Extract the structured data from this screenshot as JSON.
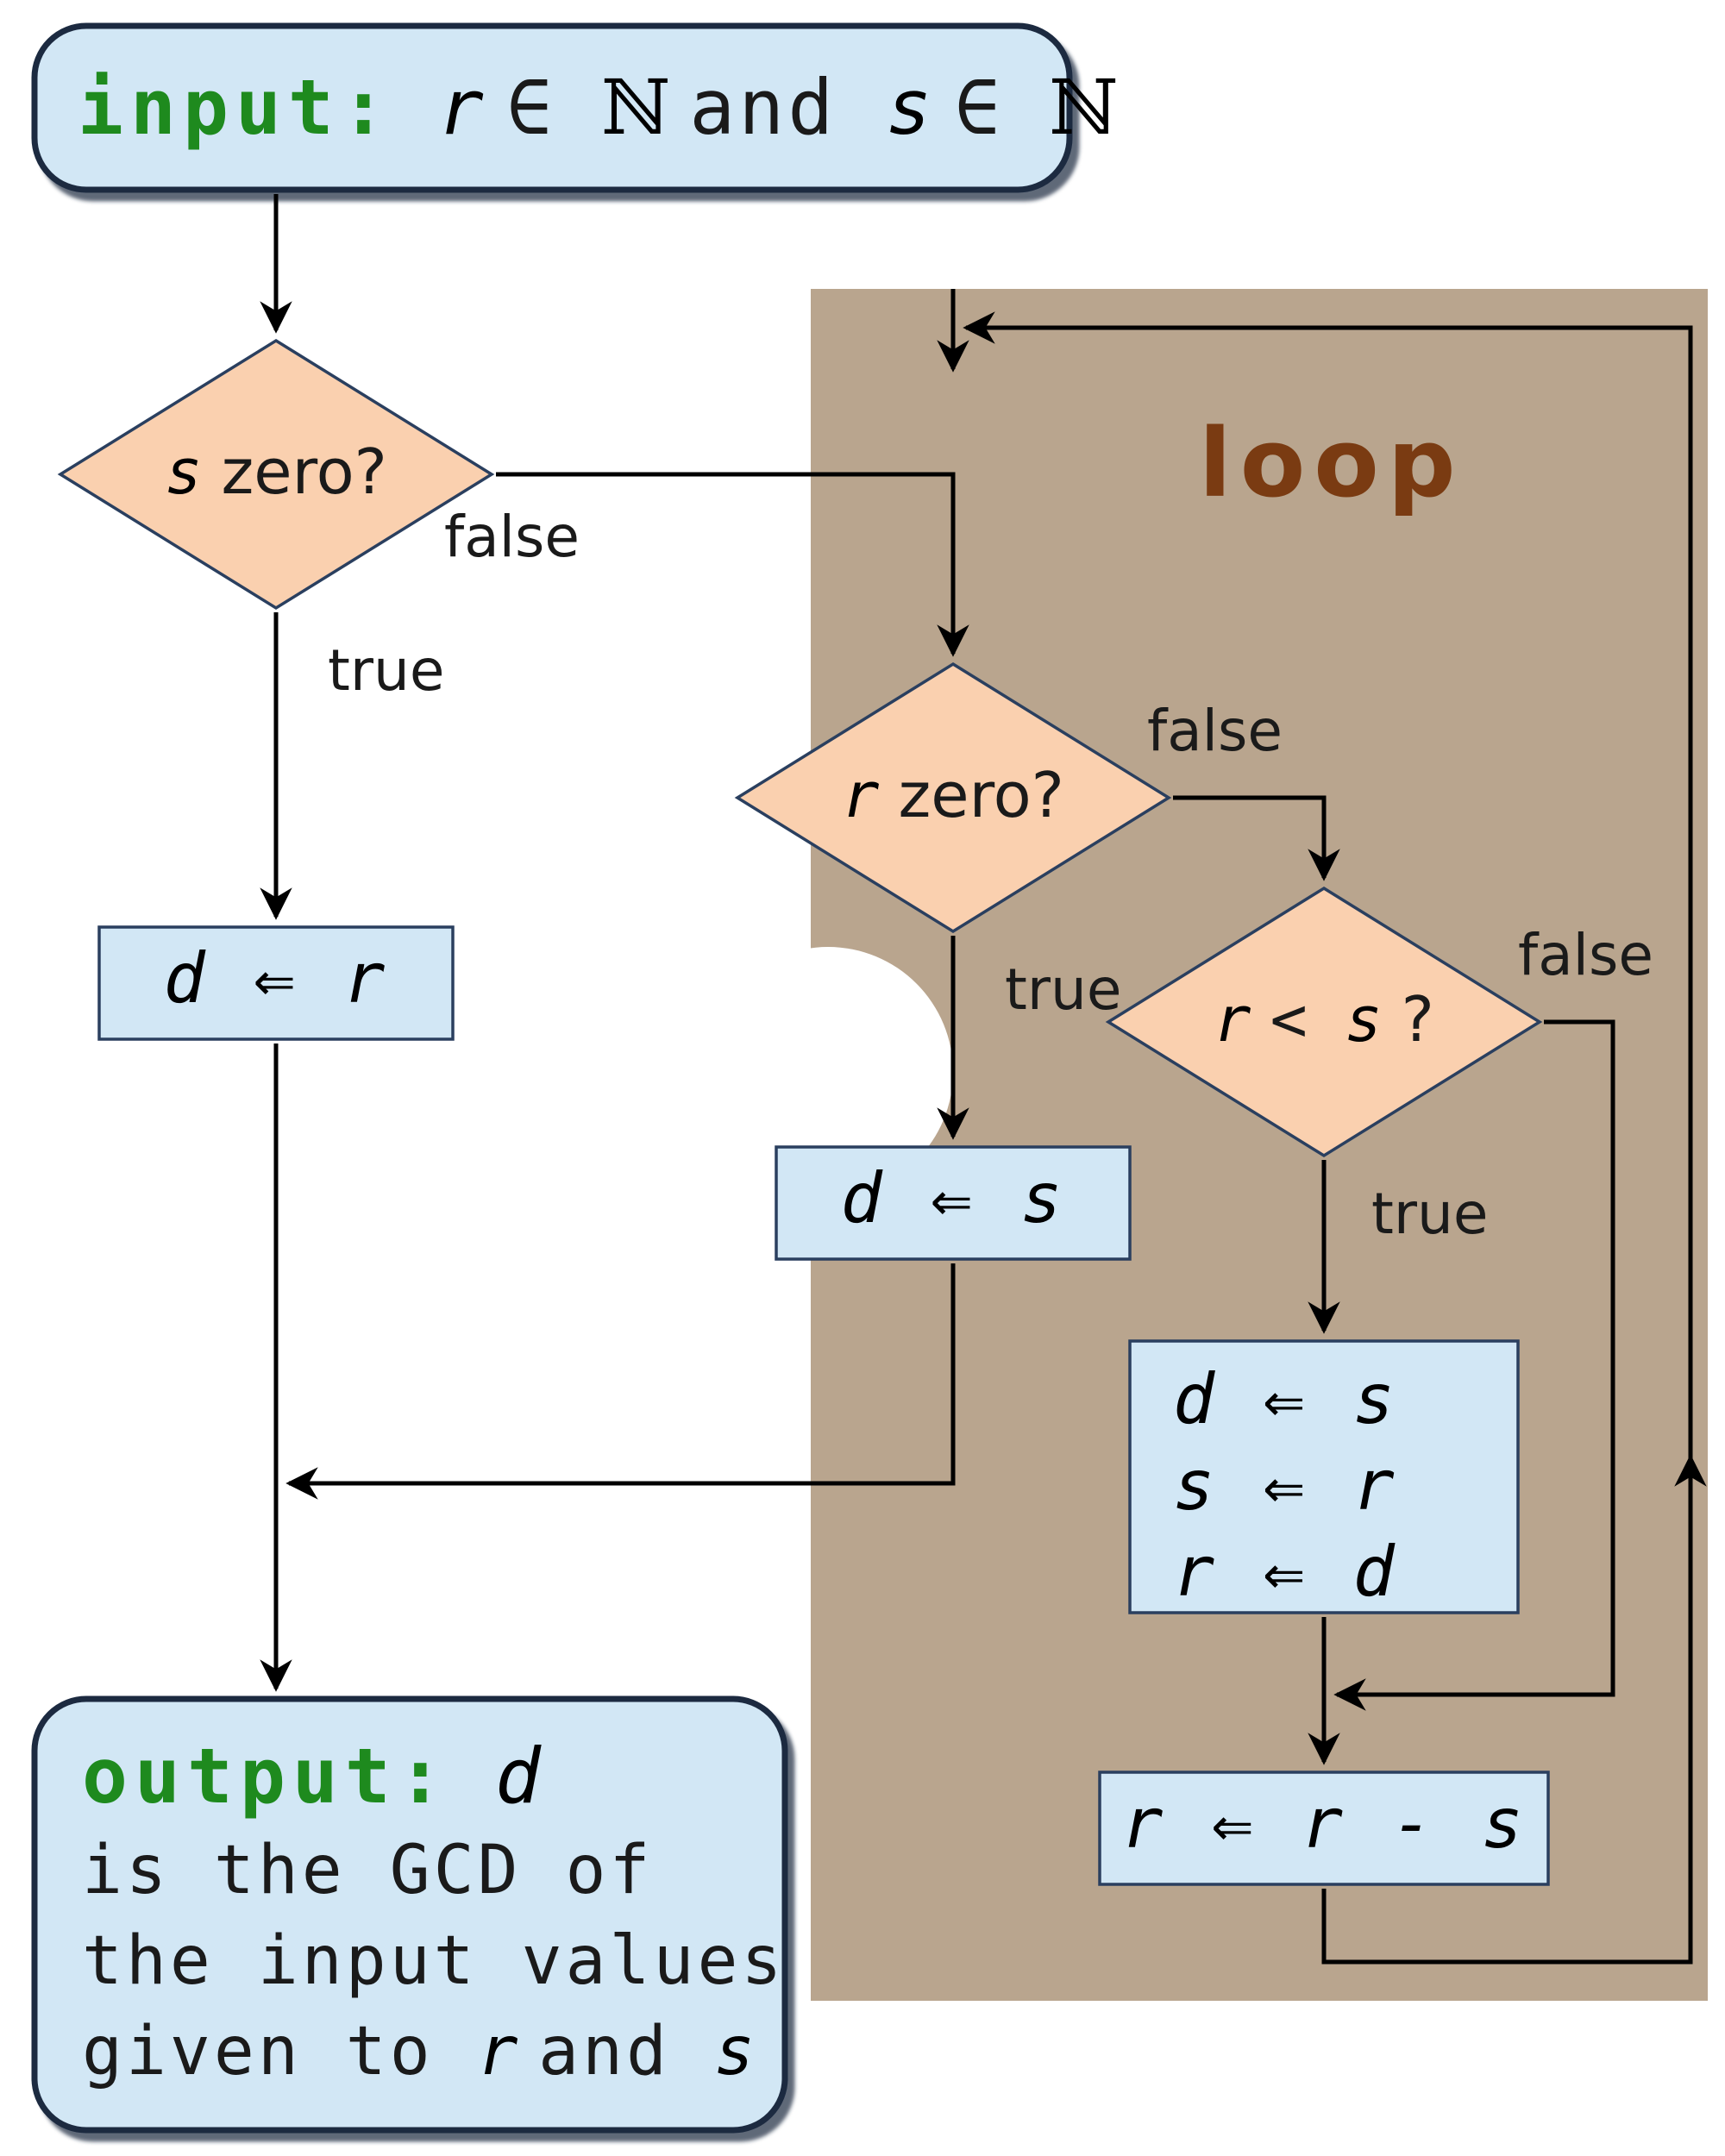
{
  "colors": {
    "io_fill": "#d2e7f5",
    "io_stroke": "#1a2940",
    "proc_fill": "#d2e7f5",
    "proc_stroke": "#2a3f5f",
    "diamond_fill": "#fad0af",
    "diamond_stroke": "#2a3f5f",
    "loop_bg": "#b9a58e",
    "loop_label": "#7a3b12",
    "keyword": "#1e8a1e"
  },
  "input": {
    "keyword": "input:",
    "expr_parts": {
      "r": "r",
      "in1": " ∈ ",
      "set": "ℕ",
      "and": " and ",
      "s": "s",
      "in2": " ∈ "
    }
  },
  "loop_label": "loop",
  "decisions": {
    "s_zero": {
      "text_var": "s",
      "text_rest": " zero?",
      "true": "true",
      "false": "false"
    },
    "r_zero": {
      "text_var": "r",
      "text_rest": " zero?",
      "true": "true",
      "false": "false"
    },
    "r_lt_s": {
      "text_var1": "r",
      "op": " < ",
      "text_var2": "s",
      "q": " ?",
      "true": "true",
      "false": "false"
    }
  },
  "processes": {
    "d_gets_r": "d ⇐ r",
    "d_gets_s": "d ⇐ s",
    "swap": [
      "d ⇐ s",
      "s ⇐ r",
      "r ⇐ d"
    ],
    "r_sub": "r ⇐ r - s"
  },
  "output": {
    "keyword": "output:",
    "var": "d",
    "lines": [
      "is the GCD of",
      "the input values",
      "given to "
    ],
    "tail_r": "r",
    "tail_and": " and ",
    "tail_s": "s"
  }
}
